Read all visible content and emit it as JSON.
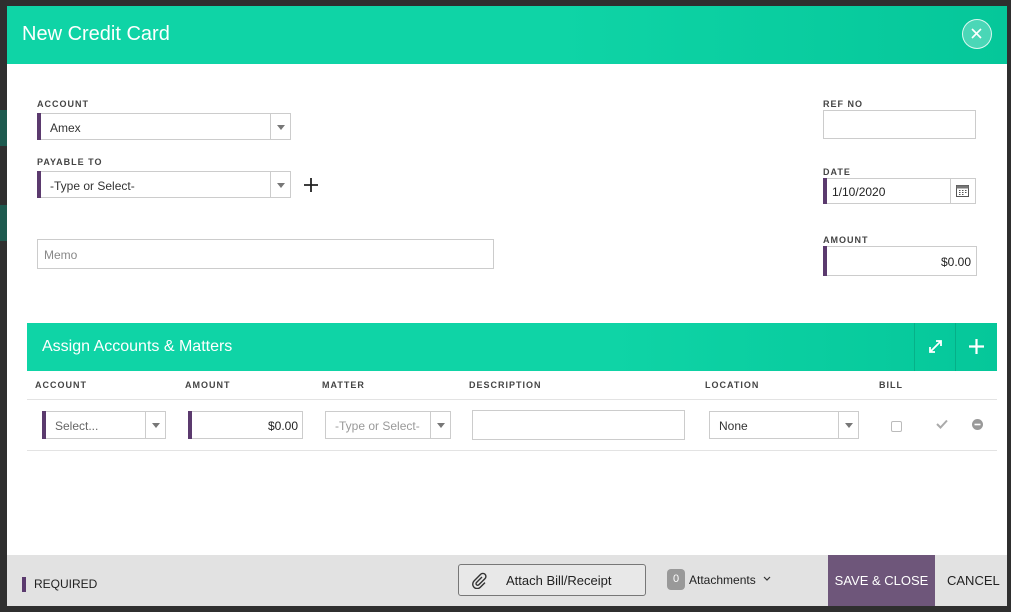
{
  "modal": {
    "title": "New Credit Card"
  },
  "form": {
    "account_label": "ACCOUNT",
    "account_value": "Amex",
    "payable_label": "PAYABLE TO",
    "payable_placeholder": "-Type or Select-",
    "memo_placeholder": "Memo",
    "refno_label": "REF NO",
    "refno_value": "",
    "date_label": "DATE",
    "date_value": "1/10/2020",
    "amount_label": "AMOUNT",
    "amount_value": "$0.00"
  },
  "assign": {
    "title": "Assign Accounts & Matters",
    "columns": [
      "ACCOUNT",
      "AMOUNT",
      "MATTER",
      "DESCRIPTION",
      "LOCATION",
      "BILL"
    ],
    "row": {
      "account": "Select...",
      "amount": "$0.00",
      "matter": "-Type or Select-",
      "description": "",
      "location": "None",
      "bill_checked": false
    }
  },
  "footer": {
    "required_label": "REQUIRED",
    "attach_label": "Attach Bill/Receipt",
    "attachments_count": "0",
    "attachments_label": "Attachments",
    "save_label": "SAVE & CLOSE",
    "cancel_label": "CANCEL"
  },
  "colors": {
    "accent": "#0fd4a6",
    "required": "#5b3a6e",
    "save": "#6e567a"
  }
}
